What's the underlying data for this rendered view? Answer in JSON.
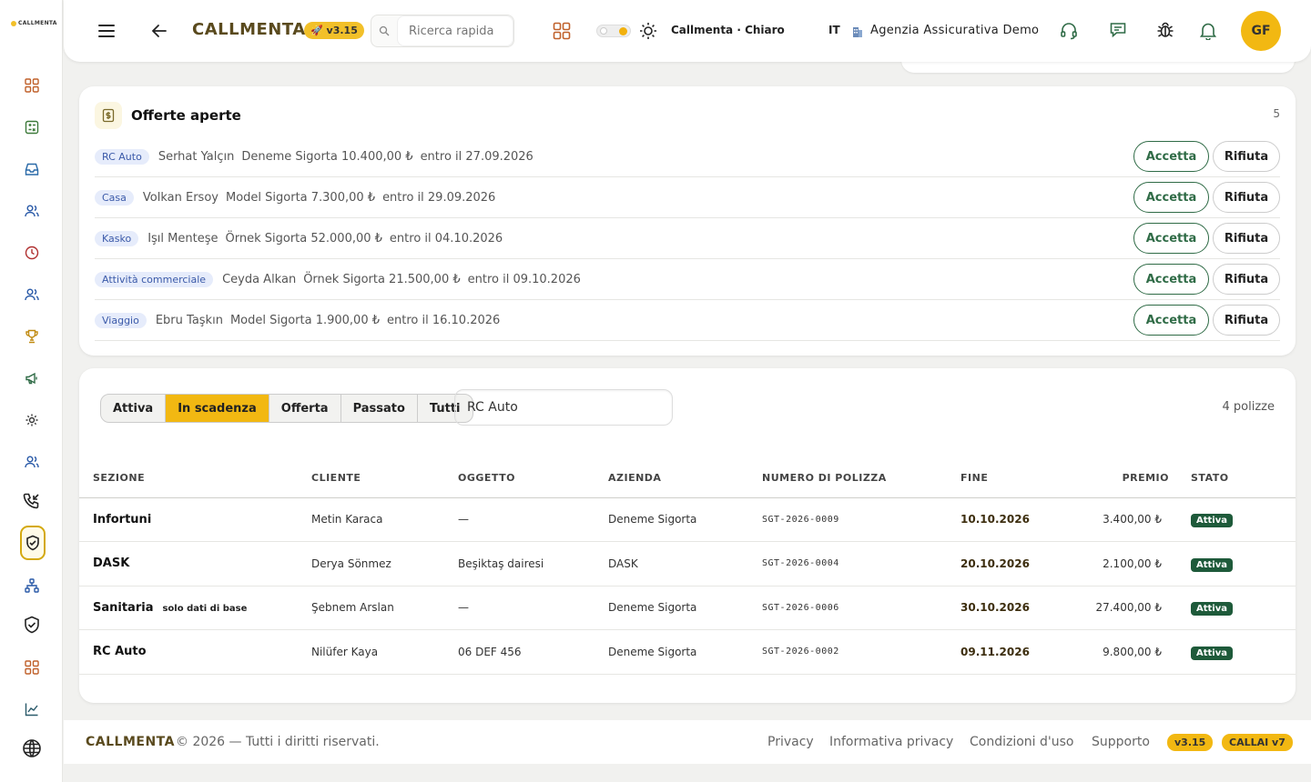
{
  "sidebar": {
    "logo": "CALLMENTA",
    "icons": [
      "dashboard-icon",
      "calculator-icon",
      "inbox-icon",
      "contacts-icon",
      "clock-icon",
      "users-icon",
      "trophy-icon",
      "megaphone-icon",
      "settings-link-icon",
      "team-icon",
      "phone-transfer-icon",
      "policy-shield-icon",
      "network-icon",
      "shield-check-icon",
      "apps-icon",
      "chart-icon",
      "globe-icon"
    ]
  },
  "topbar": {
    "brand": "CALLMENTA",
    "version": "v3.15",
    "search_placeholder": "Ricerca rapida",
    "theme_label": "Callmenta · Chiaro",
    "lang": "IT",
    "agency": "Agenzia Assicurativa Demo",
    "avatar": "GF"
  },
  "offers": {
    "title": "Offerte aperte",
    "count": "5",
    "accept_label": "Accetta",
    "reject_label": "Rifiuta",
    "rows": [
      {
        "tag": "RC Auto",
        "client": "Serhat Yalçın",
        "detail": "Deneme Sigorta 10.400,00 ₺",
        "due": "entro il 27.09.2026"
      },
      {
        "tag": "Casa",
        "client": "Volkan Ersoy",
        "detail": "Model Sigorta 7.300,00 ₺",
        "due": "entro il 29.09.2026"
      },
      {
        "tag": "Kasko",
        "client": "Işıl Menteşe",
        "detail": "Örnek Sigorta 52.000,00 ₺",
        "due": "entro il 04.10.2026"
      },
      {
        "tag": "Attività commerciale",
        "client": "Ceyda Alkan",
        "detail": "Örnek Sigorta 21.500,00 ₺",
        "due": "entro il 09.10.2026"
      },
      {
        "tag": "Viaggio",
        "client": "Ebru Taşkın",
        "detail": "Model Sigorta 1.900,00 ₺",
        "due": "entro il 16.10.2026"
      }
    ]
  },
  "policies": {
    "filters": [
      "Attiva",
      "In scadenza",
      "Offerta",
      "Passato",
      "Tutti"
    ],
    "active_filter": "In scadenza",
    "filter_value": "RC Auto",
    "count": "4 polizze",
    "columns": [
      "SEZIONE",
      "CLIENTE",
      "OGGETTO",
      "AZIENDA",
      "NUMERO DI POLIZZA",
      "FINE",
      "PREMIO",
      "STATO"
    ],
    "rows": [
      {
        "section": "Infortuni",
        "sub": "",
        "client": "Metin Karaca",
        "object": "—",
        "company": "Deneme Sigorta",
        "number": "SGT-2026-0009",
        "end": "10.10.2026",
        "premium": "3.400,00 ₺",
        "status": "Attiva"
      },
      {
        "section": "DASK",
        "sub": "",
        "client": "Derya Sönmez",
        "object": "Beşiktaş dairesi",
        "company": "DASK",
        "number": "SGT-2026-0004",
        "end": "20.10.2026",
        "premium": "2.100,00 ₺",
        "status": "Attiva"
      },
      {
        "section": "Sanitaria",
        "sub": "solo dati di base",
        "client": "Şebnem Arslan",
        "object": "—",
        "company": "Deneme Sigorta",
        "number": "SGT-2026-0006",
        "end": "30.10.2026",
        "premium": "27.400,00 ₺",
        "status": "Attiva"
      },
      {
        "section": "RC Auto",
        "sub": "",
        "client": "Nilüfer Kaya",
        "object": "06 DEF 456",
        "company": "Deneme Sigorta",
        "number": "SGT-2026-0002",
        "end": "09.11.2026",
        "premium": "9.800,00 ₺",
        "status": "Attiva"
      }
    ]
  },
  "footer": {
    "brand": "CALLMENTA",
    "copyright": "© 2026 — Tutti i diritti riservati.",
    "links": [
      "Privacy",
      "Informativa privacy",
      "Condizioni d'uso",
      "Supporto"
    ],
    "version": "v3.15",
    "callai": "CALLAI v7"
  },
  "colors": {
    "accent": "#f2b812",
    "brand": "#5a4a1e",
    "success": "#1e5a3a",
    "tag_bg": "#e6ecfb"
  }
}
